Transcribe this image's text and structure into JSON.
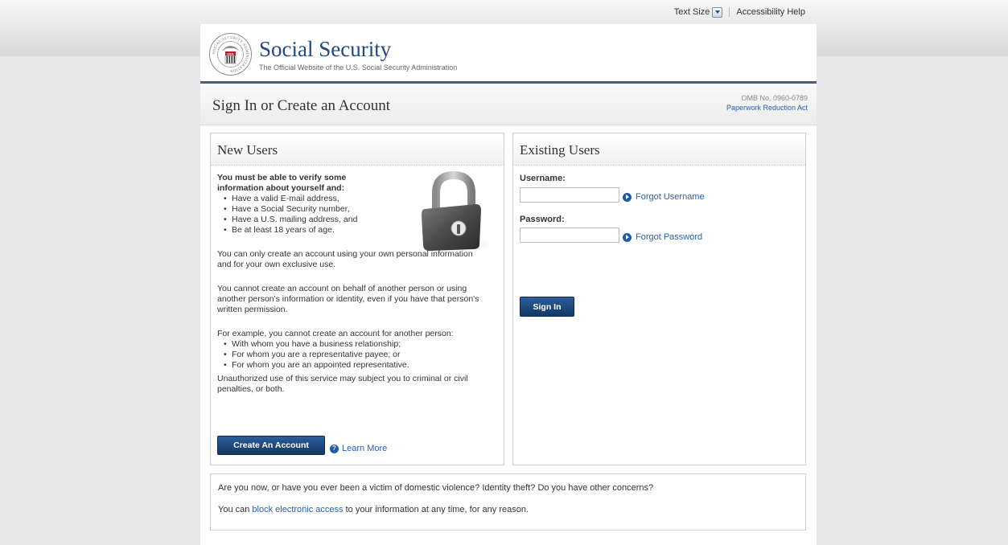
{
  "top_links": {
    "text_size": "Text Size",
    "accessibility_help": "Accessibility Help"
  },
  "header": {
    "site_title": "Social Security",
    "site_subtitle": "The Official Website of the U.S. Social Security Administration",
    "seal_text": "SOCIAL SECURITY ADMINISTRATION",
    "seal_usa": "USA"
  },
  "title_bar": {
    "title": "Sign In or Create an Account",
    "omb": "OMB No. 0960-0789",
    "paperwork_link": "Paperwork Reduction Act"
  },
  "new_users": {
    "heading": "New Users",
    "lead": "You must be able to verify some information about yourself and:",
    "requirements": [
      "Have a valid E-mail address,",
      "Have a Social Security number,",
      "Have a U.S. mailing address, and",
      "Be at least 18 years of age."
    ],
    "para1": "You can only create an account using your own personal information and for your own exclusive use.",
    "para2": "You cannot create an account on behalf of another person or using another person's information or identity, even if you have that person's written permission.",
    "para3": "For example, you cannot create an account for another person:",
    "examples": [
      "With whom you have a business relationship;",
      "For whom you are a representative payee; or",
      "For whom you are an appointed representative."
    ],
    "para4": "Unauthorized use of this service may subject you to criminal or civil penalties, or both.",
    "create_button": "Create An Account",
    "learn_more": "Learn More",
    "help_glyph": "?"
  },
  "existing_users": {
    "heading": "Existing Users",
    "username_label": "Username:",
    "username_value": "",
    "forgot_username": "Forgot Username",
    "password_label": "Password:",
    "password_value": "",
    "forgot_password": "Forgot Password",
    "sign_in_button": "Sign In"
  },
  "bottom": {
    "line1": "Are you now, or have you ever been a victim of domestic violence? Identity theft? Do you have other concerns?",
    "line2_pre": "You can",
    "line2_link": "block electronic access",
    "line2_post": "to your information at any time, for any reason."
  },
  "colors": {
    "brand_blue": "#20497f",
    "link_blue": "#2a5fa8",
    "button_dark": "#123865",
    "header_rule": "#4a5b86"
  }
}
